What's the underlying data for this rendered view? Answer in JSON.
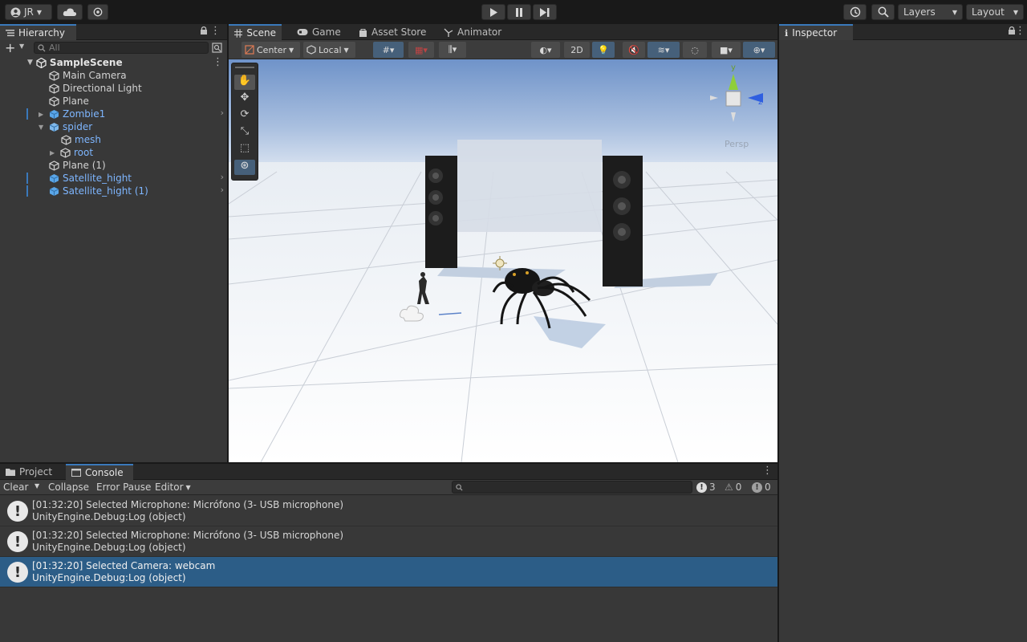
{
  "toolbar": {
    "account_label": "JR",
    "layers_label": "Layers",
    "layout_label": "Layout"
  },
  "hierarchy": {
    "tab_label": "Hierarchy",
    "search_placeholder": "All",
    "scene_name": "SampleScene",
    "items": [
      {
        "label": "Main Camera"
      },
      {
        "label": "Directional Light"
      },
      {
        "label": "Plane"
      },
      {
        "label": "Zombie1"
      },
      {
        "label": "spider"
      },
      {
        "label": "mesh"
      },
      {
        "label": "root"
      },
      {
        "label": "Plane (1)"
      },
      {
        "label": "Satellite_hight"
      },
      {
        "label": "Satellite_hight (1)"
      }
    ]
  },
  "scene": {
    "tabs": [
      {
        "label": "Scene"
      },
      {
        "label": "Game"
      },
      {
        "label": "Asset Store"
      },
      {
        "label": "Animator"
      }
    ],
    "pivot_label": "Center",
    "space_label": "Local",
    "mode_2d_label": "2D",
    "gizmo_persp_label": "Persp",
    "gizmo_x": "x",
    "gizmo_y": "y",
    "gizmo_z": "z"
  },
  "inspector": {
    "tab_label": "Inspector"
  },
  "console": {
    "tabs": [
      {
        "label": "Project"
      },
      {
        "label": "Console"
      }
    ],
    "clear_label": "Clear",
    "collapse_label": "Collapse",
    "error_pause_label": "Error Pause",
    "editor_label": "Editor",
    "count_logs": "3",
    "count_warnings": "0",
    "count_errors": "0",
    "entries": [
      {
        "line1": "[01:32:20] Selected Microphone: Micrófono (3- USB microphone)",
        "line2": "UnityEngine.Debug:Log (object)"
      },
      {
        "line1": "[01:32:20] Selected Microphone: Micrófono (3- USB microphone)",
        "line2": "UnityEngine.Debug:Log (object)"
      },
      {
        "line1": "[01:32:20] Selected Camera: webcam",
        "line2": "UnityEngine.Debug:Log (object)"
      }
    ]
  }
}
